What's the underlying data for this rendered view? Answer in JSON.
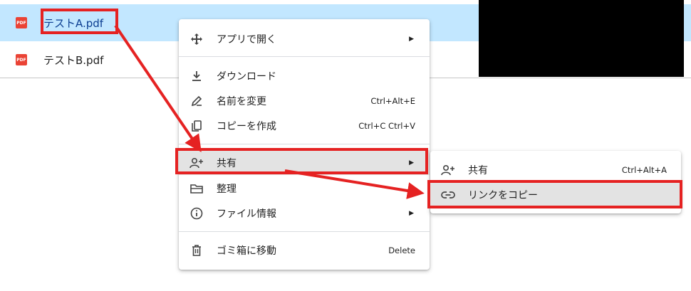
{
  "files": [
    {
      "name": "テストA.pdf",
      "icon": "pdf-icon",
      "icon_text": "PDF",
      "selected": true
    },
    {
      "name": "テストB.pdf",
      "icon": "pdf-icon",
      "icon_text": "PDF",
      "selected": false
    }
  ],
  "context_menu": {
    "items": [
      {
        "label": "アプリで開く",
        "icon": "open-with-icon",
        "shortcut": "",
        "submenu": true
      },
      {
        "label": "ダウンロード",
        "icon": "download-icon",
        "shortcut": "",
        "submenu": false
      },
      {
        "label": "名前を変更",
        "icon": "rename-icon",
        "shortcut": "Ctrl+Alt+E",
        "submenu": false
      },
      {
        "label": "コピーを作成",
        "icon": "copy-icon",
        "shortcut": "Ctrl+C Ctrl+V",
        "submenu": false
      },
      {
        "label": "共有",
        "icon": "share-icon",
        "shortcut": "",
        "submenu": true
      },
      {
        "label": "整理",
        "icon": "folder-icon",
        "shortcut": "",
        "submenu": true
      },
      {
        "label": "ファイル情報",
        "icon": "info-icon",
        "shortcut": "",
        "submenu": true
      },
      {
        "label": "ゴミ箱に移動",
        "icon": "trash-icon",
        "shortcut": "Delete",
        "submenu": false
      }
    ]
  },
  "share_submenu": {
    "items": [
      {
        "label": "共有",
        "icon": "share-icon",
        "shortcut": "Ctrl+Alt+A"
      },
      {
        "label": "リンクをコピー",
        "icon": "link-icon",
        "shortcut": ""
      }
    ]
  },
  "colors": {
    "selection": "#c2e7ff",
    "annotation_red": "#e52222",
    "hover": "#e3e3e3"
  }
}
